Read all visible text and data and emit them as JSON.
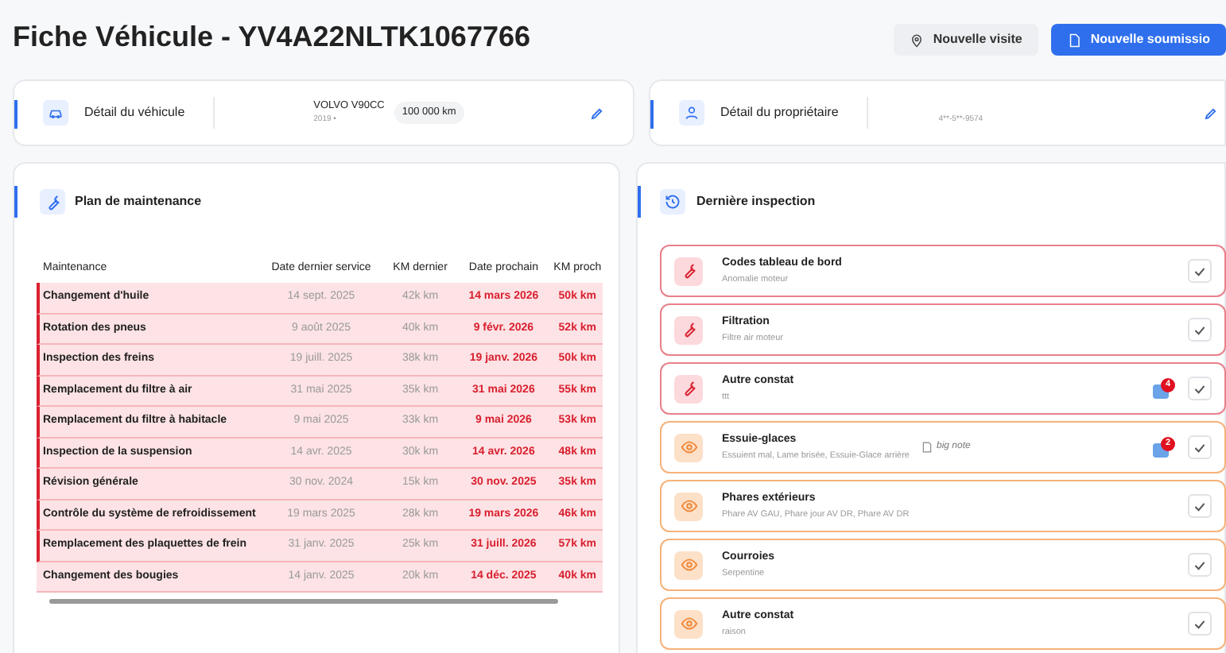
{
  "header": {
    "title": "Fiche Véhicule - YV4A22NLTK1067766",
    "buttons": [
      {
        "kind": "secondary",
        "label": "Nouvelle visite"
      },
      {
        "kind": "primary",
        "label": "Nouvelle soumissio"
      }
    ]
  },
  "vehicle_card": {
    "title": "Détail du véhicule",
    "model": "VOLVO V90CC",
    "subtitle": "2019 •",
    "mileage": "100 000 km"
  },
  "owner_card": {
    "title": "Détail du propriétaire",
    "phone": "4**-5**-9574"
  },
  "maintenance": {
    "title": "Plan de maintenance",
    "columns": [
      "Maintenance",
      "Date dernier service",
      "KM dernier",
      "Date prochain",
      "KM proch"
    ],
    "rows": [
      {
        "name": "Changement d'huile",
        "last_date": "14 sept. 2025",
        "last_km": "42k km",
        "next_date": "14 mars 2026",
        "next_km": "50k km",
        "overdue": true
      },
      {
        "name": "Rotation des pneus",
        "last_date": "9 août 2025",
        "last_km": "40k km",
        "next_date": "9 févr. 2026",
        "next_km": "52k km",
        "overdue": true
      },
      {
        "name": "Inspection des freins",
        "last_date": "19 juill. 2025",
        "last_km": "38k km",
        "next_date": "19 janv. 2026",
        "next_km": "50k km",
        "overdue": true
      },
      {
        "name": "Remplacement du filtre à air",
        "last_date": "31 mai 2025",
        "last_km": "35k km",
        "next_date": "31 mai 2026",
        "next_km": "55k km",
        "overdue": true
      },
      {
        "name": "Remplacement du filtre à habitacle",
        "last_date": "9 mai 2025",
        "last_km": "33k km",
        "next_date": "9 mai 2026",
        "next_km": "53k km",
        "overdue": true
      },
      {
        "name": "Inspection de la suspension",
        "last_date": "14 avr. 2025",
        "last_km": "30k km",
        "next_date": "14 avr. 2026",
        "next_km": "48k km",
        "overdue": true
      },
      {
        "name": "Révision générale",
        "last_date": "30 nov. 2024",
        "last_km": "15k km",
        "next_date": "30 nov. 2025",
        "next_km": "35k km",
        "overdue": true
      },
      {
        "name": "Contrôle du système de refroidissement",
        "last_date": "19 mars 2025",
        "last_km": "28k km",
        "next_date": "19 mars 2026",
        "next_km": "46k km",
        "overdue": true
      },
      {
        "name": "Remplacement des plaquettes de frein",
        "last_date": "31 janv. 2025",
        "last_km": "25k km",
        "next_date": "31 juill. 2026",
        "next_km": "57k km",
        "overdue": true
      },
      {
        "name": "Changement des bougies",
        "last_date": "14 janv. 2025",
        "last_km": "20k km",
        "next_date": "14 déc. 2025",
        "next_km": "40k km",
        "overdue": false
      }
    ]
  },
  "inspection": {
    "title": "Dernière inspection",
    "items": [
      {
        "kind": "urgent",
        "title": "Codes tableau de bord",
        "detail": "Anomalie moteur"
      },
      {
        "kind": "urgent",
        "title": "Filtration",
        "detail": "Filtre air moteur"
      },
      {
        "kind": "urgent",
        "title": "Autre constat",
        "detail": "ttt",
        "photos": "4"
      },
      {
        "kind": "warning",
        "title": "Essuie-glaces",
        "detail": "Essuient mal, Lame brisée, Essuie-Glace arrière",
        "note": "big note",
        "photos": "2"
      },
      {
        "kind": "warning",
        "title": "Phares extérieurs",
        "detail": "Phare AV GAU, Phare jour AV DR, Phare AV DR"
      },
      {
        "kind": "warning",
        "title": "Courroies",
        "detail": "Serpentine"
      },
      {
        "kind": "warning",
        "title": "Autre constat",
        "detail": "raison"
      }
    ]
  }
}
